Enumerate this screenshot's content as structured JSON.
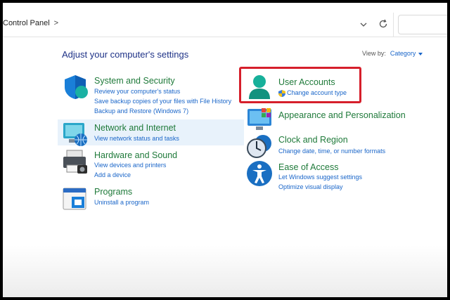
{
  "breadcrumb": {
    "label": "Control Panel",
    "separator": ">"
  },
  "heading": "Adjust your computer's settings",
  "view_by": {
    "label": "View by:",
    "value": "Category"
  },
  "categories_left": [
    {
      "title": "System and Security",
      "links": [
        "Review your computer's status",
        "Save backup copies of your files with File History",
        "Backup and Restore (Windows 7)"
      ],
      "icon": "shield-icon"
    },
    {
      "title": "Network and Internet",
      "links": [
        "View network status and tasks"
      ],
      "icon": "network-globe-icon"
    },
    {
      "title": "Hardware and Sound",
      "links": [
        "View devices and printers",
        "Add a device"
      ],
      "icon": "printer-icon"
    },
    {
      "title": "Programs",
      "links": [
        "Uninstall a program"
      ],
      "icon": "programs-icon"
    }
  ],
  "categories_right": [
    {
      "title": "User Accounts",
      "links": [
        "Change account type"
      ],
      "icon": "user-icon"
    },
    {
      "title": "Appearance and Personalization",
      "links": [],
      "icon": "monitor-palette-icon"
    },
    {
      "title": "Clock and Region",
      "links": [
        "Change date, time, or number formats"
      ],
      "icon": "clock-globe-icon"
    },
    {
      "title": "Ease of Access",
      "links": [
        "Let Windows suggest settings",
        "Optimize visual display"
      ],
      "icon": "accessibility-icon"
    }
  ],
  "colors": {
    "title_green": "#1f7a3a",
    "link_blue": "#1a66c9",
    "heading_blue": "#1e3287",
    "highlight_red": "#d61f2b"
  }
}
